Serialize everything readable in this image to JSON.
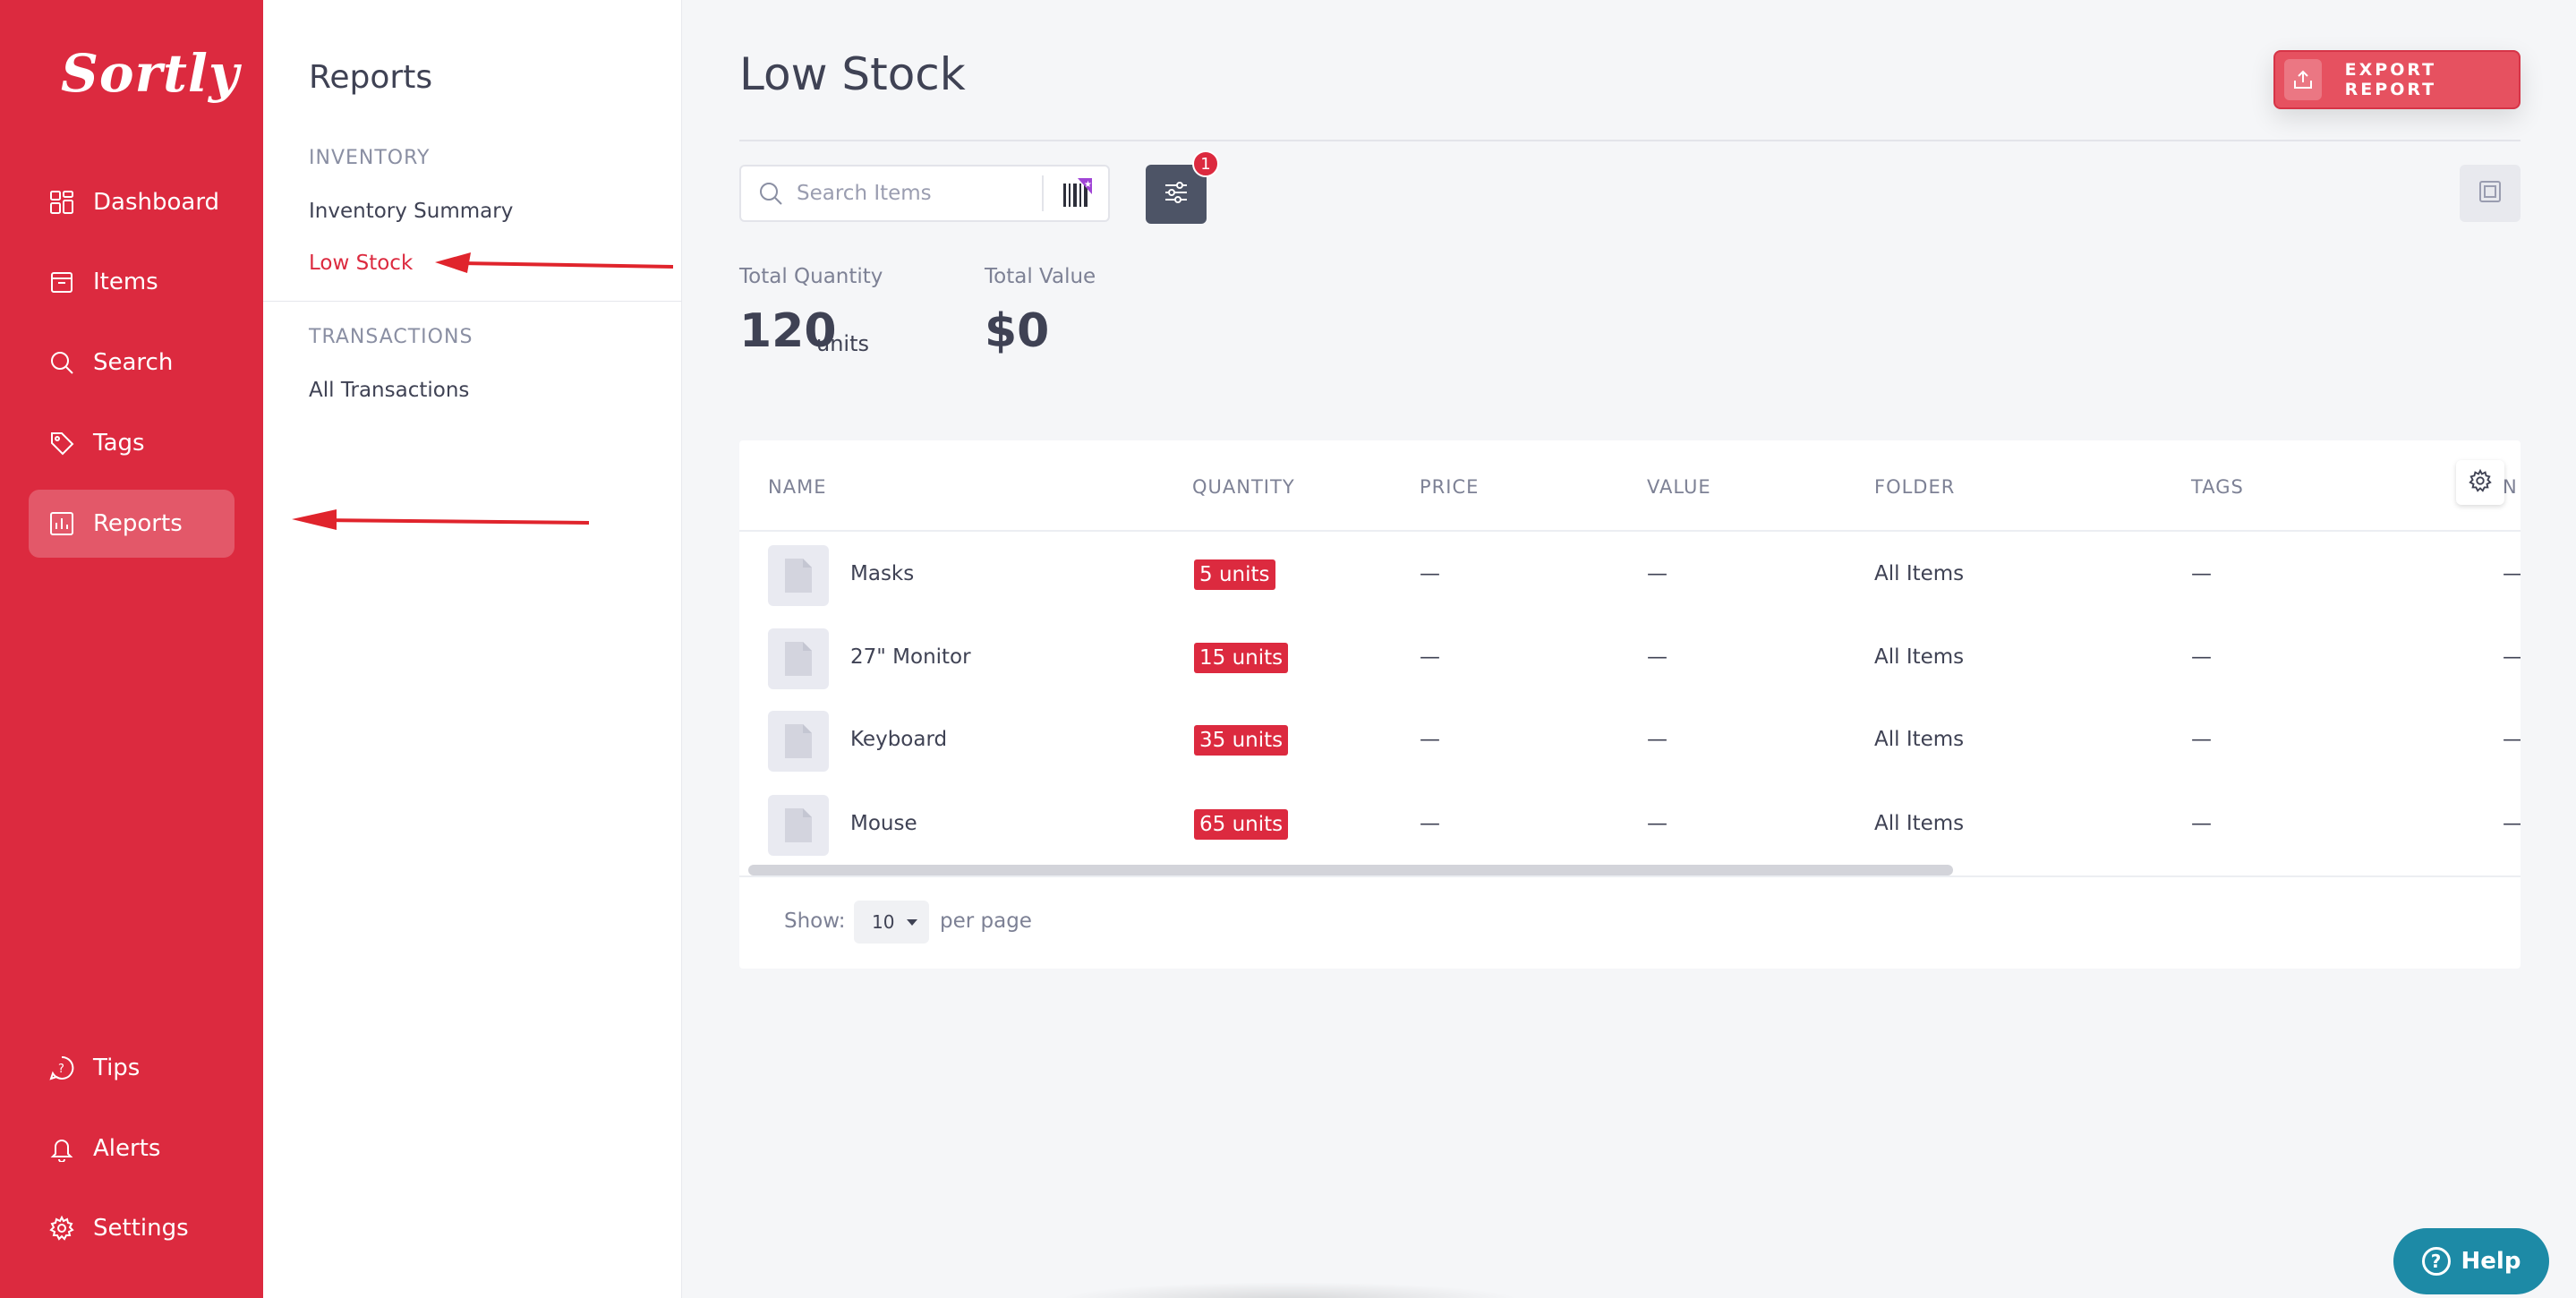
{
  "app": {
    "logo_text": "Sortly",
    "brand_color": "#dc2a3f"
  },
  "sidebar": {
    "items": [
      {
        "label": "Dashboard",
        "icon": "dashboard-icon"
      },
      {
        "label": "Items",
        "icon": "items-icon"
      },
      {
        "label": "Search",
        "icon": "search-icon"
      },
      {
        "label": "Tags",
        "icon": "tag-icon"
      },
      {
        "label": "Reports",
        "icon": "reports-icon",
        "active": true
      }
    ],
    "bottom_items": [
      {
        "label": "Tips",
        "icon": "tips-icon"
      },
      {
        "label": "Alerts",
        "icon": "bell-icon"
      },
      {
        "label": "Settings",
        "icon": "gear-icon"
      }
    ]
  },
  "reports_panel": {
    "title": "Reports",
    "sections": [
      {
        "label": "INVENTORY",
        "links": [
          "Inventory Summary",
          "Low Stock"
        ]
      },
      {
        "label": "TRANSACTIONS",
        "links": [
          "All Transactions"
        ]
      }
    ],
    "active_link": "Low Stock"
  },
  "main": {
    "title": "Low Stock",
    "export_label": "EXPORT REPORT",
    "search_placeholder": "Search Items",
    "filter_count": "1",
    "stats": {
      "total_quantity_label": "Total Quantity",
      "total_quantity_value": "120",
      "total_quantity_unit": "units",
      "total_value_label": "Total Value",
      "total_value_value": "$0"
    },
    "table": {
      "columns": [
        "NAME",
        "QUANTITY",
        "PRICE",
        "VALUE",
        "FOLDER",
        "TAGS",
        "N"
      ],
      "rows": [
        {
          "name": "Masks",
          "quantity": "5 units",
          "price": "—",
          "value": "—",
          "folder": "All Items",
          "tags": "—",
          "extra": "—"
        },
        {
          "name": "27\" Monitor",
          "quantity": "15 units",
          "price": "—",
          "value": "—",
          "folder": "All Items",
          "tags": "—",
          "extra": "—"
        },
        {
          "name": "Keyboard",
          "quantity": "35 units",
          "price": "—",
          "value": "—",
          "folder": "All Items",
          "tags": "—",
          "extra": "—"
        },
        {
          "name": "Mouse",
          "quantity": "65 units",
          "price": "—",
          "value": "—",
          "folder": "All Items",
          "tags": "—",
          "extra": "—"
        }
      ]
    },
    "pagination": {
      "show_label": "Show:",
      "per_page_value": "10",
      "per_page_label": "per page"
    }
  },
  "help": {
    "label": "Help"
  }
}
